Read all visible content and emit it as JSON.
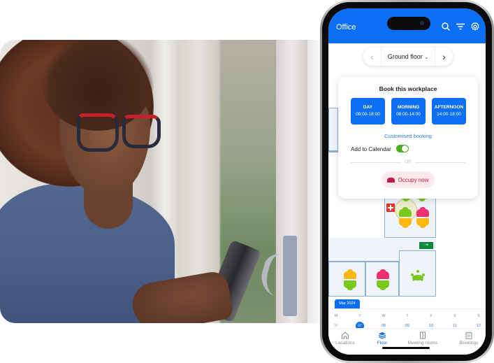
{
  "photo": {
    "description": "Woman with red glasses using a smartphone by a window"
  },
  "app": {
    "title": "Office",
    "header_icons": [
      "search-icon",
      "filter-icon",
      "gear-icon"
    ],
    "accent_color": "#0b6ff5"
  },
  "floor_selector": {
    "prev_icon": "‹",
    "label": "Ground floor",
    "dropdown_icon": "⌄",
    "next_icon": "›"
  },
  "booking_card": {
    "heading": "Book this workplace",
    "slots": [
      {
        "name": "DAY",
        "time": "08:00-18:00"
      },
      {
        "name": "MORNING",
        "time": "08:00-14:00"
      },
      {
        "name": "AFTERNOON",
        "time": "14:00-18:00"
      }
    ],
    "custom_link": "Customised booking",
    "calendar_label": "Add to Calendar",
    "calendar_toggle_on": true,
    "divider_text": "OR",
    "occupy_label": "Occupy now"
  },
  "map": {
    "status_colors": {
      "available": "#78c81e",
      "occupied": "#ef2f6e",
      "reserved": "#ffb713"
    },
    "exit_sign": "⇢"
  },
  "calendar": {
    "month_label": "Mar 2024",
    "days": [
      {
        "name": "M",
        "date": "06",
        "state": "past"
      },
      {
        "name": "T",
        "date": "07",
        "state": "selected"
      },
      {
        "name": "W",
        "date": "08",
        "state": "future"
      },
      {
        "name": "T",
        "date": "09",
        "state": "future"
      },
      {
        "name": "F",
        "date": "10",
        "state": "future"
      },
      {
        "name": "S",
        "date": "11",
        "state": "future"
      },
      {
        "name": "S",
        "date": "12",
        "state": "future"
      }
    ]
  },
  "tabbar": {
    "items": [
      {
        "label": "Locations",
        "icon": "home-icon",
        "active": false
      },
      {
        "label": "Floor",
        "icon": "layers-icon",
        "active": true
      },
      {
        "label": "Meeting rooms",
        "icon": "door-icon",
        "active": false
      },
      {
        "label": "Bookings",
        "icon": "calendar-icon",
        "active": false
      }
    ]
  }
}
